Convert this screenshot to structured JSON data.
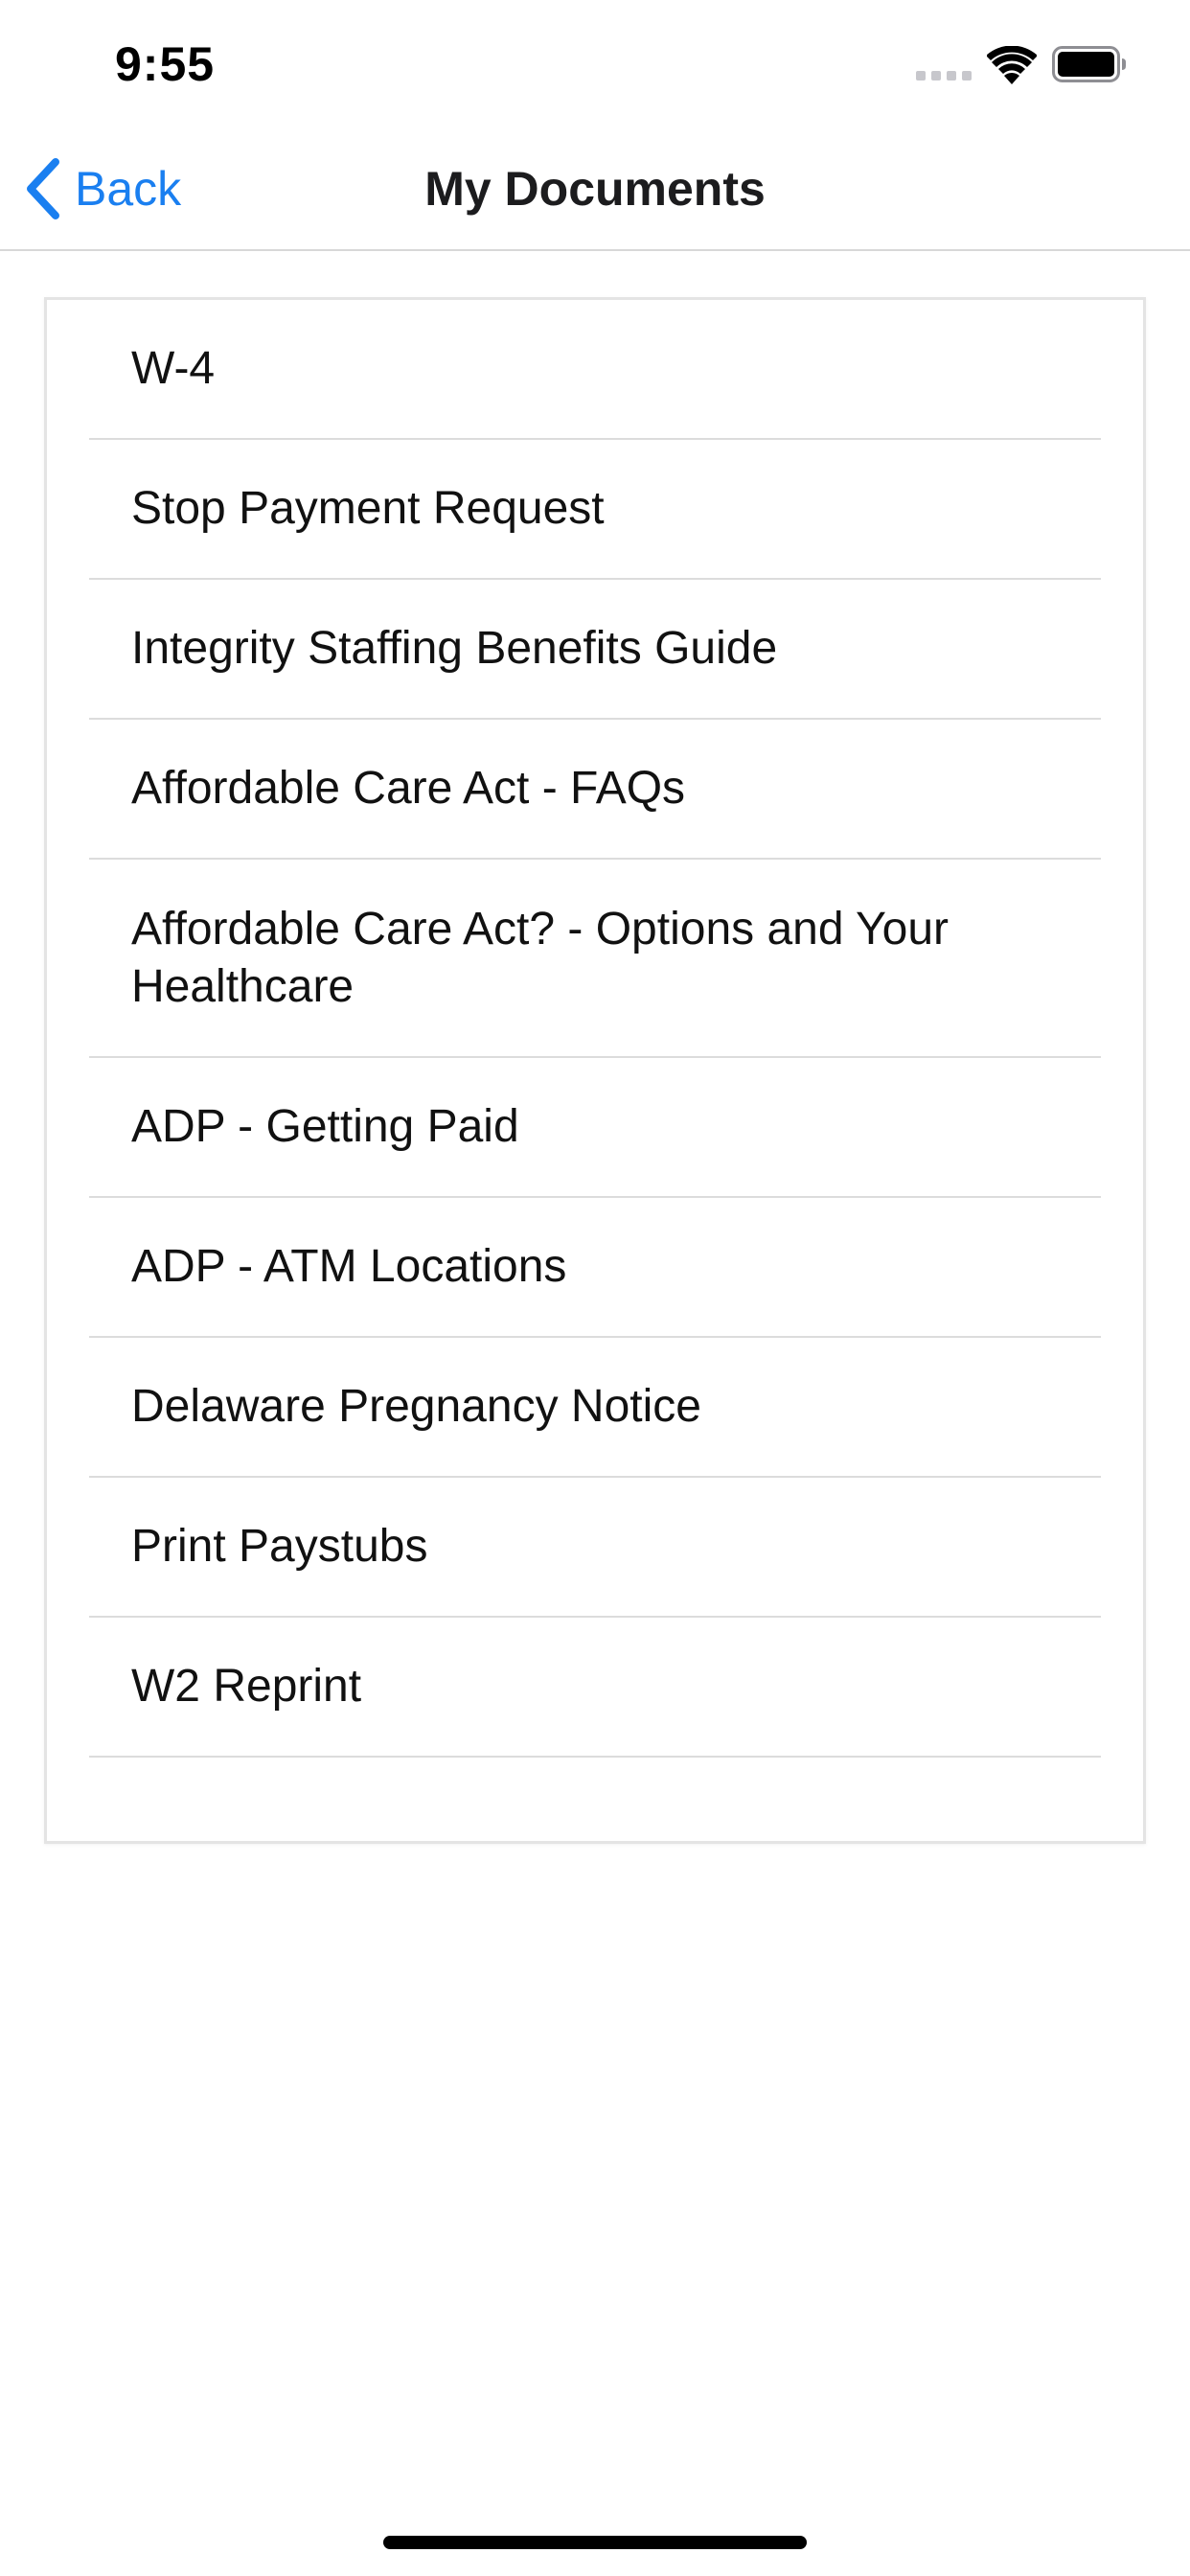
{
  "status_bar": {
    "time": "9:55"
  },
  "nav": {
    "back_label": "Back",
    "title": "My Documents"
  },
  "documents": [
    {
      "label": "W-4"
    },
    {
      "label": "Stop Payment Request"
    },
    {
      "label": "Integrity Staffing Benefits Guide"
    },
    {
      "label": "Affordable Care Act - FAQs"
    },
    {
      "label": "Affordable Care Act? - Options and Your Healthcare"
    },
    {
      "label": "ADP - Getting Paid"
    },
    {
      "label": "ADP - ATM Locations"
    },
    {
      "label": "Delaware Pregnancy Notice"
    },
    {
      "label": "Print Paystubs"
    },
    {
      "label": "W2 Reprint"
    }
  ],
  "colors": {
    "accent": "#1a7ff0",
    "separator": "#dcdcdc",
    "text": "#111111"
  },
  "icons": [
    "back-chevron-icon",
    "cellular-signal-icon",
    "wifi-icon",
    "battery-icon"
  ]
}
